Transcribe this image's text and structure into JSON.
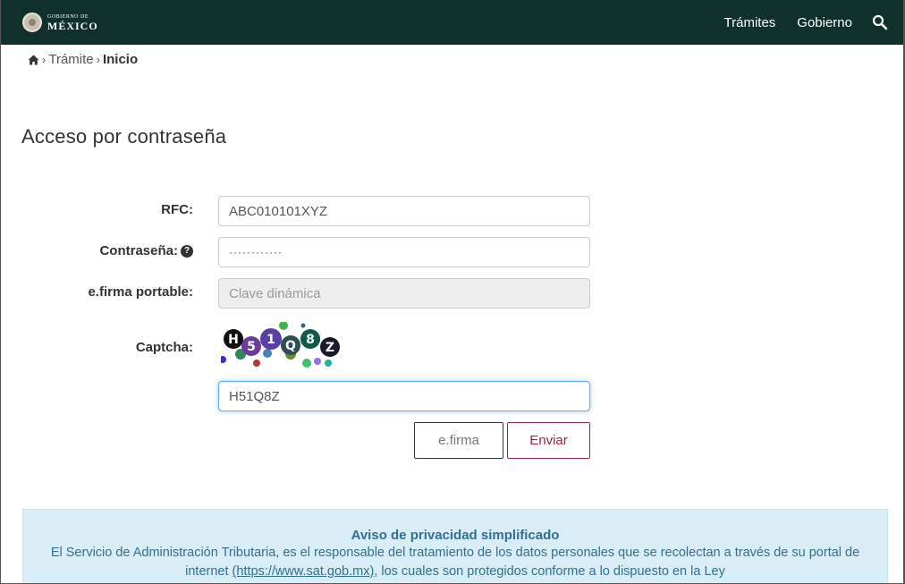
{
  "header": {
    "logo_small": "GOBIERNO DE",
    "logo_big": "MÉXICO",
    "nav": [
      "Trámites",
      "Gobierno"
    ],
    "colors": {
      "background": "#10312b",
      "text": "#ffffff"
    }
  },
  "breadcrumb": {
    "home_icon": "home-icon",
    "items": [
      "Trámite",
      "Inicio"
    ]
  },
  "page_title": "Acceso por contraseña",
  "form": {
    "rfc_label": "RFC:",
    "rfc_value": "ABC010101XYZ",
    "password_label": "Contraseña:",
    "password_value": "············",
    "efirma_portable_label": "e.firma portable:",
    "efirma_portable_placeholder": "Clave dinámica",
    "captcha_label": "Captcha:",
    "captcha_image_text": "H51Q8Z",
    "captcha_value": "H51Q8Z"
  },
  "buttons": {
    "efirma": "e.firma",
    "enviar": "Enviar",
    "colors": {
      "enviar": "#9d2449"
    }
  },
  "notice": {
    "title": "Aviso de privacidad simplificado",
    "text_before_link": "El Servicio de Administración Tributaria, es el responsable del tratamiento de los datos personales que se recolectan a través de su portal de internet ",
    "link": "(https://www.sat.gob.mx)",
    "text_after_link": ", los cuales son protegidos conforme a lo dispuesto en la Ley",
    "colors": {
      "background": "#d9edf7",
      "text": "#31708f"
    }
  }
}
